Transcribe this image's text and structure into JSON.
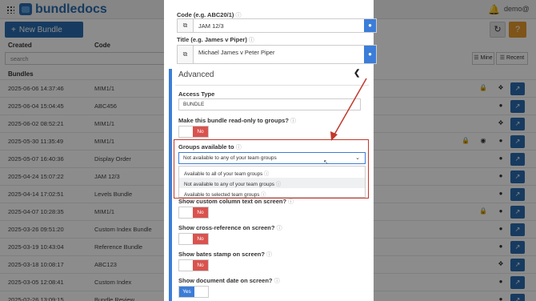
{
  "app": {
    "name": "bundledocs",
    "user": "demo@",
    "new_bundle_label": "New Bundle",
    "columns": {
      "created": "Created",
      "code": "Code"
    },
    "search_placeholder": "search",
    "mine_label": "Mine",
    "recent_label": "Recent",
    "bundles_label": "Bundles"
  },
  "rows": [
    {
      "created": "2025-06-06 14:37:46",
      "code": "MIM1/1",
      "title": ""
    },
    {
      "created": "2025-06-04 15:04:45",
      "code": "ABC456",
      "title": ""
    },
    {
      "created": "2025-06-02 08:52:21",
      "code": "MIM1/1",
      "title": ""
    },
    {
      "created": "2025-05-30 11:35:49",
      "code": "MIM1/1",
      "title": ""
    },
    {
      "created": "2025-05-07 16:40:36",
      "code": "Display Order",
      "title": ""
    },
    {
      "created": "2025-04-24 15:07:22",
      "code": "JAM 12/3",
      "title": ""
    },
    {
      "created": "2025-04-14 17:02:51",
      "code": "Levels Bundle",
      "title": ""
    },
    {
      "created": "2025-04-07 10:28:35",
      "code": "MIM1/1",
      "title": ""
    },
    {
      "created": "2025-03-26 09:51:20",
      "code": "Custom Index Bundle",
      "title": ""
    },
    {
      "created": "2025-03-19 10:43:04",
      "code": "Reference Bundle",
      "title": ""
    },
    {
      "created": "2025-03-18 10:08:17",
      "code": "ABC123",
      "title": ""
    },
    {
      "created": "2025-03-05 12:08:41",
      "code": "Custom Index",
      "title": ""
    },
    {
      "created": "2025-02-26 13:09:15",
      "code": "Bundle Review",
      "title": "Bundle Review"
    }
  ],
  "form": {
    "code_label": "Code (e.g. ABC20/1)",
    "code_value": "JAM 12/3",
    "title_label": "Title (e.g. James v Piper)",
    "title_value": "Michael James v Peter Piper",
    "advanced_label": "Advanced",
    "access_type_label": "Access Type",
    "access_type_value": "BUNDLE",
    "readonly_label": "Make this bundle read-only to groups?",
    "readonly_value": "No",
    "groups_label": "Groups available to",
    "groups_value": "Not available to any of your team groups",
    "groups_options": [
      "Available to all of your team groups",
      "Not available to any of your team groups",
      "Available to selected team groups"
    ],
    "custom_col_label": "Show custom column text on screen?",
    "custom_col_value": "No",
    "cross_ref_label": "Show cross-reference on screen?",
    "cross_ref_value": "No",
    "bates_label": "Show bates stamp on screen?",
    "bates_value": "No",
    "doc_date_label": "Show document date on screen?",
    "doc_date_value": "Yes"
  },
  "colors": {
    "brand": "#2b6cb0",
    "accent": "#3b7dd8",
    "danger": "#d9534f",
    "highlight": "#c0392b"
  }
}
